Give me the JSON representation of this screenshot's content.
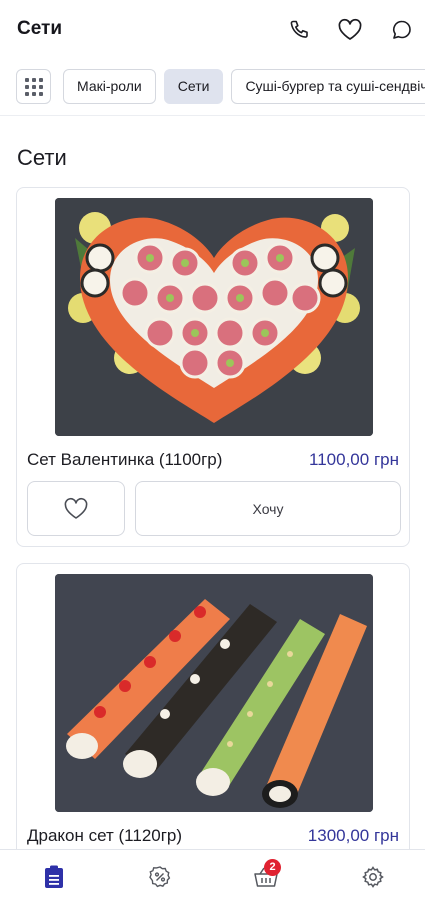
{
  "header": {
    "title": "Сети",
    "icons": [
      "phone-icon",
      "heart-icon",
      "chat-icon"
    ]
  },
  "categories": {
    "items": [
      {
        "label": "Макі-роли",
        "active": false
      },
      {
        "label": "Сети",
        "active": true
      },
      {
        "label": "Суші-бургер та суші-сендвіч",
        "active": false
      }
    ]
  },
  "section": {
    "title": "Сети"
  },
  "products": [
    {
      "name": "Сет Валентинка (1100гр)",
      "price": "1100,00 грн",
      "button_label": "Хочу"
    },
    {
      "name": "Дракон сет (1120гр)",
      "price": "1300,00 грн"
    }
  ],
  "bottom_nav": {
    "items": [
      "menu-icon",
      "discount-icon",
      "cart-icon",
      "settings-icon"
    ],
    "cart_badge": "2"
  },
  "colors": {
    "accent": "#34369a",
    "active_chip": "#dfe3ee",
    "badge": "#e02231"
  }
}
